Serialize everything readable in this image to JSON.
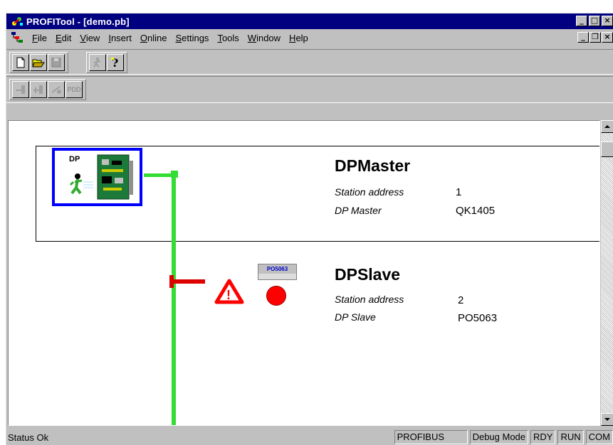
{
  "window": {
    "title": "PROFITool - [demo.pb]",
    "caption_minimize": "_",
    "caption_maximize": "□",
    "caption_close": "×",
    "mdi_minimize": "_",
    "mdi_restore": "❐",
    "mdi_close": "×"
  },
  "menu": {
    "items": [
      {
        "label": "File"
      },
      {
        "label": "Edit"
      },
      {
        "label": "View"
      },
      {
        "label": "Insert"
      },
      {
        "label": "Online"
      },
      {
        "label": "Settings"
      },
      {
        "label": "Tools"
      },
      {
        "label": "Window"
      },
      {
        "label": "Help"
      }
    ]
  },
  "toolbar1": {
    "icons": [
      "new-file-icon",
      "open-folder-icon",
      "save-icon",
      "run-icon",
      "help-icon"
    ]
  },
  "toolbar2": {
    "icons": [
      "add-master-icon",
      "add-slave-icon",
      "link-icon"
    ],
    "pdd_label": "PDD"
  },
  "network": {
    "master": {
      "title": "DPMaster",
      "icon_label": "DP",
      "station_address_label": "Station address",
      "station_address_value": "1",
      "type_label": "DP Master",
      "type_value": "QK1405"
    },
    "slave": {
      "title": "DPSlave",
      "chip_label": "PO5063",
      "station_address_label": "Station address",
      "station_address_value": "2",
      "type_label": "DP Slave",
      "type_value": "PO5063"
    },
    "colors": {
      "bus": "#33dd33",
      "error": "#dd0000",
      "master_frame": "#0000ff"
    }
  },
  "statusbar": {
    "status": "Status Ok",
    "panels": [
      "PROFIBUS",
      "Debug Mode",
      "RDY",
      "RUN",
      "COM"
    ]
  }
}
